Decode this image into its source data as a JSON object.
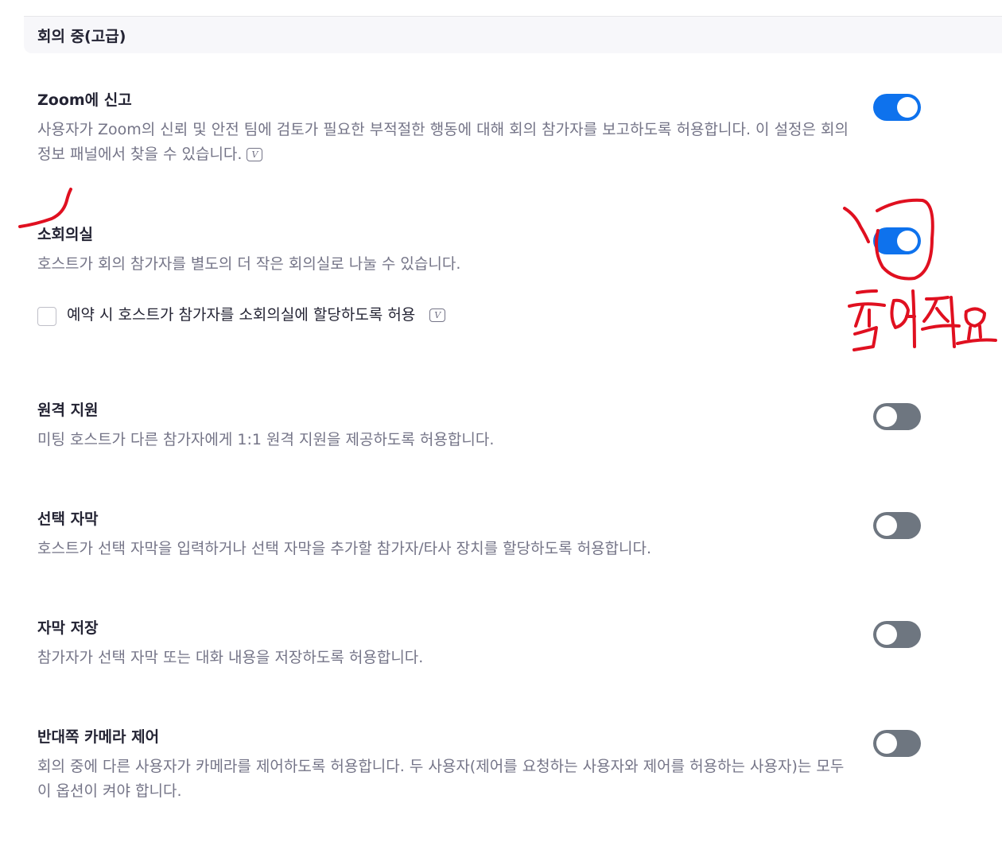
{
  "section": {
    "title": "회의 중(고급)"
  },
  "settings": [
    {
      "title": "Zoom에 신고",
      "desc": "사용자가 Zoom의 신뢰 및 안전 팀에 검토가 필요한 부적절한 행동에 대해 회의 참가자를 보고하도록 허용합니다. 이 설정은 회의 정보 패널에서 찾을 수 있습니다.",
      "icon": "v-icon",
      "on": true
    },
    {
      "title": "소회의실",
      "desc": "호스트가 회의 참가자를 별도의 더 작은 회의실로 나눌 수 있습니다.",
      "on": true,
      "sub_option": {
        "label": "예약 시 호스트가 참가자를 소회의실에 할당하도록 허용",
        "checked": false,
        "icon": "v-icon"
      }
    },
    {
      "title": "원격 지원",
      "desc": "미팅 호스트가 다른 참가자에게 1:1 원격 지원을 제공하도록 허용합니다.",
      "on": false
    },
    {
      "title": "선택 자막",
      "desc": "호스트가 선택 자막을 입력하거나 선택 자막을 추가할 참가자/타사 장치를 할당하도록 허용합니다.",
      "on": false
    },
    {
      "title": "자막 저장",
      "desc": "참가자가 선택 자막 또는 대화 내용을 저장하도록 허용합니다.",
      "on": false
    },
    {
      "title": "반대쪽 카메라 제어",
      "desc": "회의 중에 다른 사용자가 카메라를 제어하도록 허용합니다. 두 사용자(제어를 요청하는 사용자와 제어를 허용하는 사용자)는 모두 이 옵션이 켜야 합니다.",
      "on": false
    }
  ],
  "annotation": {
    "text": "눌러줘요",
    "color": "#e01020"
  },
  "colors": {
    "toggle_on": "#0e72ed",
    "toggle_off": "#6e7680",
    "text_secondary": "#747487"
  }
}
